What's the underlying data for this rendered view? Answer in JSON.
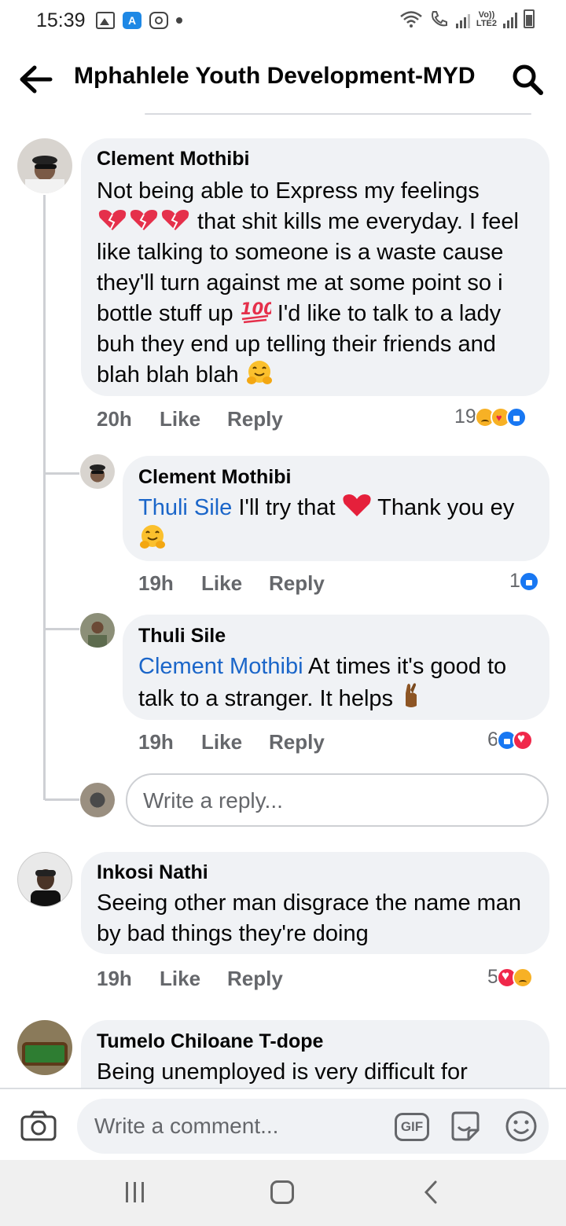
{
  "status_bar": {
    "time": "15:39",
    "lte_label_top": "Vo))",
    "lte_label_bottom": "LTE2"
  },
  "header": {
    "title": "Mphahlele Youth Development-MYD",
    "back_icon": "arrow-left-icon",
    "search_icon": "search-icon"
  },
  "comments": [
    {
      "author": "Clement  Mothibi",
      "text_1": "Not being able to Express my feelings",
      "text_2": " that shit kills me everyday. I feel like talking to someone is a waste cause they'll turn against me at some point so i bottle stuff up ",
      "text_3": " I'd like to talk to a lady buh they end up telling their friends and blah blah blah ",
      "time": "20h",
      "like": "Like",
      "reply": "Reply",
      "reaction_count": "19",
      "reactions": [
        "sad",
        "care",
        "like"
      ],
      "replies": [
        {
          "author": "Clement  Mothibi",
          "mention": "Thuli Sile",
          "text_1": " I'll try that ",
          "text_2": " Thank you ey ",
          "time": "19h",
          "like": "Like",
          "reply": "Reply",
          "reaction_count": "1",
          "reactions": [
            "like"
          ]
        },
        {
          "author": "Thuli Sile",
          "mention": "Clement  Mothibi",
          "text_1": " At times it's good to talk to a stranger. It helps ",
          "time": "19h",
          "like": "Like",
          "reply": "Reply",
          "reaction_count": "6",
          "reactions": [
            "like",
            "love"
          ]
        }
      ],
      "reply_placeholder": "Write a reply..."
    },
    {
      "author": "Inkosi Nathi",
      "text": "Seeing other man disgrace the name man by bad things they're doing",
      "time": "19h",
      "like": "Like",
      "reply": "Reply",
      "reaction_count": "5",
      "reactions": [
        "love",
        "sad"
      ]
    },
    {
      "author": "Tumelo Chiloane T-dope",
      "text": "Being unemployed is  very difficult  for"
    }
  ],
  "comment_bar": {
    "placeholder": "Write a comment...",
    "gif_label": "GIF"
  }
}
